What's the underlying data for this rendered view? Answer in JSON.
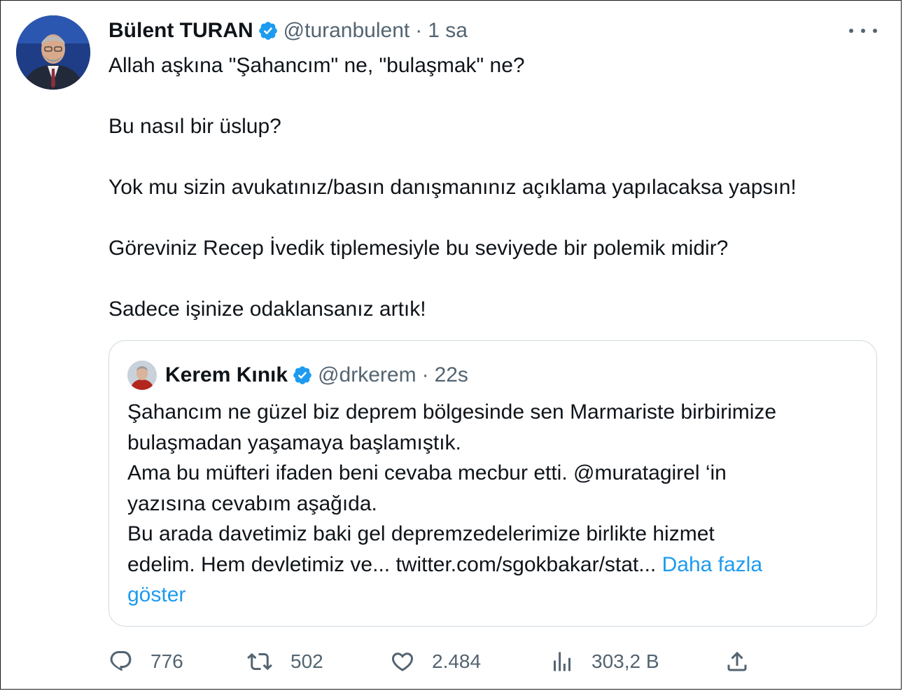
{
  "tweet": {
    "author_name": "Bülent TURAN",
    "handle": "@turanbulent",
    "separator": "·",
    "time": "1 sa",
    "paragraphs": [
      "Allah aşkına \"Şahancım\" ne, \"bulaşmak\" ne?",
      "Bu nasıl bir üslup?",
      "Yok mu sizin avukatınız/basın danışmanınız açıklama yapılacaksa yapsın!",
      "Göreviniz Recep İvedik tiplemesiyle bu seviyede bir polemik midir?",
      "Sadece işinize odaklansanız artık!"
    ]
  },
  "quote": {
    "author_name": "Kerem Kınık",
    "handle": "@drkerem",
    "separator": "·",
    "time": "22s",
    "lines": [
      "Şahancım ne güzel biz deprem bölgesinde sen Marmariste birbirimize",
      "bulaşmadan yaşamaya başlamıştık.",
      "Ama bu müfteri ifaden beni cevaba mecbur etti. @muratagirel ‘in",
      "yazısına cevabım aşağıda.",
      "Bu arada davetimiz baki gel depremzedelerimize birlikte hizmet",
      "edelim. Hem devletimiz ve... twitter.com/sgokbakar/stat..."
    ],
    "show_more_part1": "Daha fazla",
    "show_more_part2": "göster"
  },
  "actions": {
    "replies": "776",
    "retweets": "502",
    "likes": "2.484",
    "views": "303,2 B"
  },
  "icons": {
    "verified": "verified-badge-icon",
    "more": "more-icon",
    "reply": "reply-icon",
    "retweet": "retweet-icon",
    "like": "heart-icon",
    "views": "views-icon",
    "share": "share-icon"
  },
  "colors": {
    "accent": "#1d9bf0",
    "text": "#0f1419",
    "secondary": "#536471",
    "border": "#cfd9de"
  }
}
